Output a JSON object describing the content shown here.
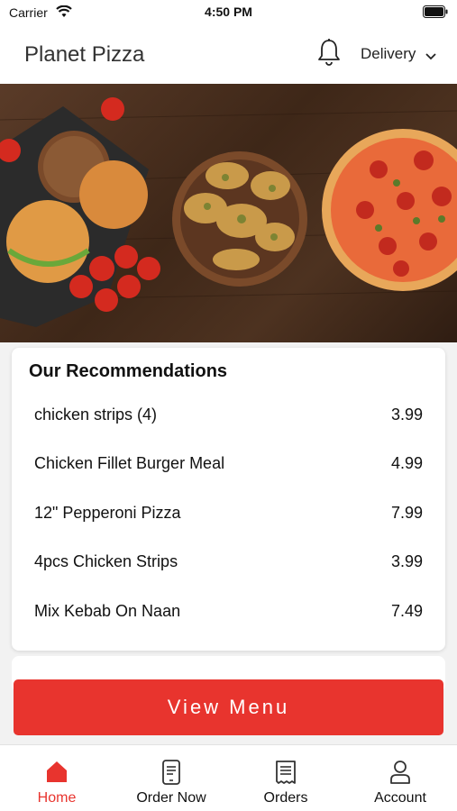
{
  "status_bar": {
    "carrier": "Carrier",
    "time": "4:50 PM"
  },
  "header": {
    "title": "Planet Pizza",
    "order_type": "Delivery"
  },
  "recommendations": {
    "title": "Our Recommendations",
    "items": [
      {
        "name": "chicken strips (4)",
        "price": "3.99"
      },
      {
        "name": "Chicken Fillet Burger Meal",
        "price": "4.99"
      },
      {
        "name": "12\" Pepperoni Pizza",
        "price": "7.99"
      },
      {
        "name": "4pcs Chicken Strips",
        "price": "3.99"
      },
      {
        "name": "Mix Kebab On Naan",
        "price": "7.49"
      }
    ]
  },
  "view_menu_label": "View Menu",
  "tabs": [
    {
      "label": "Home",
      "icon": "home-icon",
      "active": true
    },
    {
      "label": "Order Now",
      "icon": "phone-order-icon",
      "active": false
    },
    {
      "label": "Orders",
      "icon": "receipt-icon",
      "active": false
    },
    {
      "label": "Account",
      "icon": "person-icon",
      "active": false
    }
  ],
  "colors": {
    "accent": "#e8342e",
    "text": "#111111",
    "background": "#f2f2f2"
  }
}
